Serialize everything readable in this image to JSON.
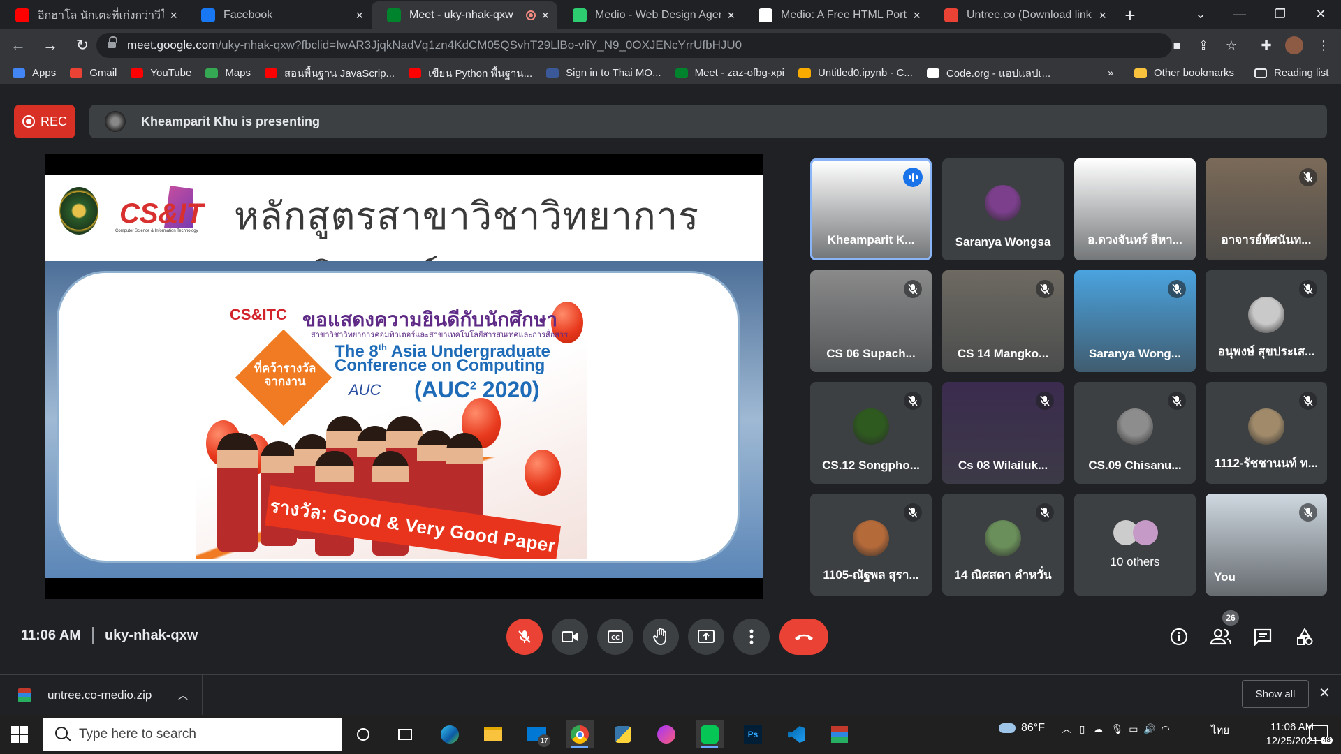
{
  "tabs": [
    {
      "title": "อิกฮาโล นักเตะที่เก่งกว่าวีโมเทิ",
      "fav_color": "#ff0000",
      "fav": "youtube-icon"
    },
    {
      "title": "Facebook",
      "fav_color": "#1877f2",
      "fav": "facebook-icon"
    },
    {
      "title": "Meet - uky-nhak-qxw",
      "fav_color": "#00832d",
      "fav": "meet-icon",
      "active": true
    },
    {
      "title": "Medio - Web Design Agenc",
      "fav_color": "#2ecc71",
      "fav": "medio-icon"
    },
    {
      "title": "Medio: A Free HTML Portfo",
      "fav_color": "#ffffff",
      "fav": "themewagon-icon"
    },
    {
      "title": "Untree.co (Download link f",
      "fav_color": "#ea4335",
      "fav": "gmail-icon"
    }
  ],
  "address": {
    "host": "meet.google.com",
    "path": "/uky-nhak-qxw?fbclid=IwAR3JjqkNadVq1zn4KdCM05QSvhT29LlBo-vliY_N9_0OXJENcYrrUfbHJU0"
  },
  "bookmarks": [
    {
      "label": "Apps",
      "color": "#4285f4",
      "icon": "apps-icon"
    },
    {
      "label": "Gmail",
      "color": "#ea4335",
      "icon": "gmail-icon"
    },
    {
      "label": "YouTube",
      "color": "#ff0000",
      "icon": "youtube-icon"
    },
    {
      "label": "Maps",
      "color": "#34a853",
      "icon": "maps-icon"
    },
    {
      "label": "สอนพื้นฐาน JavaScrip...",
      "color": "#ff0000",
      "icon": "youtube-icon"
    },
    {
      "label": "เขียน Python พื้นฐาน...",
      "color": "#ff0000",
      "icon": "youtube-icon"
    },
    {
      "label": "Sign in to Thai MO...",
      "color": "#3b5998",
      "icon": "thaimooc-icon"
    },
    {
      "label": "Meet - zaz-ofbg-xpi",
      "color": "#00832d",
      "icon": "meet-icon"
    },
    {
      "label": "Untitled0.ipynb - C...",
      "color": "#f9ab00",
      "icon": "colab-icon"
    },
    {
      "label": "Code.org - แอปแลปเ...",
      "color": "#ffffff",
      "icon": "codeorg-icon"
    }
  ],
  "bookmarks_more": "»",
  "other_bookmarks": "Other bookmarks",
  "reading_list": "Reading list",
  "meet": {
    "rec_label": "REC",
    "presenting": "Kheamparit Khu is presenting",
    "time": "11:06 AM",
    "code": "uky-nhak-qxw",
    "participant_count": "26"
  },
  "slide": {
    "title": "หลักสูตรสาขาวิชาวิทยาการคอมพิวเตอร์",
    "logo_text": "CS&IT",
    "logo_sub": "Computer Science & Information Technology",
    "poster_brand": "CS&ITC",
    "poster_congrats": "ขอแสดงความยินดีกับนักศึกษา",
    "poster_sub": "สาขาวิชาวิทยาการคอมพิวเตอร์และสาขาเทคโนโลยีสารสนเทศและการสื่อสาร",
    "award_tag": "ที่คว้ารางวัล จากงาน",
    "conf_line1": "The 8",
    "conf_sup": "th",
    "conf_line1b": " Asia Undergraduate",
    "conf_line2": "Conference on Computing",
    "auc": "(AUC",
    "auc_sup": "2",
    "auc_end": " 2020)",
    "auc_logo": "AUC",
    "ribbon": "รางวัล: Good & Very Good Paper"
  },
  "participants": [
    {
      "name": "Kheamparit K...",
      "speaking": true,
      "bg": "#ffffff"
    },
    {
      "name": "Saranya Wongsa",
      "avatar": "#7b3f8c"
    },
    {
      "name": "อ.ดวงจันทร์ สีหา...",
      "bg": "#ffffff"
    },
    {
      "name": "อาจารย์ทัศนันท...",
      "muted": true,
      "bg": "#7b6a58"
    },
    {
      "name": "CS 06 Supach...",
      "muted": true,
      "bg": "#8a8a8a"
    },
    {
      "name": "CS 14 Mangko...",
      "muted": true,
      "bg": "#6e6a62"
    },
    {
      "name": "Saranya Wong...",
      "muted": true,
      "bg": "#4aa3df"
    },
    {
      "name": "อนุพงษ์ สุขประเส...",
      "muted": true,
      "avatar": "#c9c9c9"
    },
    {
      "name": "CS.12 Songpho...",
      "muted": true,
      "avatar": "#2e5a1f"
    },
    {
      "name": "Cs 08 Wilailuk...",
      "muted": true,
      "bg": "#3b2b4f"
    },
    {
      "name": "CS.09 Chisanu...",
      "muted": true,
      "avatar": "#8d8d8d"
    },
    {
      "name": "1112-รัชชานนท์ ท...",
      "muted": true,
      "avatar": "#a08a6a"
    },
    {
      "name": "1105-ณัฐพล สุรา...",
      "muted": true,
      "avatar": "#b56a3a"
    },
    {
      "name": "14 ณิศสดา คำหวั่น",
      "muted": true,
      "avatar": "#6a8f5a"
    },
    {
      "name": "10 others",
      "others": true
    },
    {
      "name": "You",
      "muted": true,
      "bg": "#cfd8e0"
    }
  ],
  "download": {
    "file": "untree.co-medio.zip",
    "show_all": "Show all"
  },
  "taskbar": {
    "search_placeholder": "Type here to search",
    "weather": "86°F",
    "lang": "ไทย",
    "time": "11:06 AM",
    "date": "12/25/2021",
    "notif_count": "48",
    "mail_badge": "17"
  }
}
